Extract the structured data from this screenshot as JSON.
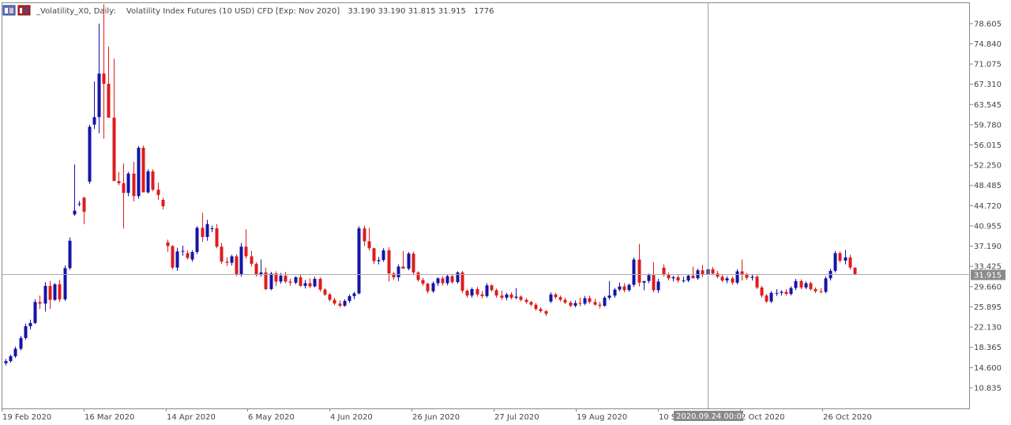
{
  "header": {
    "symbol": "_Volatility_X0, Daily:",
    "description": "Volatility Index Futures (10 USD) CFD [Exp: Nov 2020]",
    "ohlc": "33.190 33.190 31.815 31.915",
    "volume": "1776"
  },
  "crosshair": {
    "time_label": "2020.09.24 00:00"
  },
  "chart_data": {
    "type": "candlestick",
    "y_ticks": [
      "78.605",
      "74.840",
      "71.075",
      "67.310",
      "63.545",
      "59.780",
      "56.015",
      "52.250",
      "48.485",
      "44.720",
      "40.955",
      "37.190",
      "33.425",
      "29.660",
      "25.895",
      "22.130",
      "18.365",
      "14.600",
      "10.835"
    ],
    "ylim": [
      7.0,
      82.4
    ],
    "x_ticks": [
      "19 Feb 2020",
      "16 Mar 2020",
      "14 Apr 2020",
      "6 May 2020",
      "4 Jun 2020",
      "26 Jun 2020",
      "27 Jul 2020",
      "19 Aug 2020",
      "10 Sep 2020",
      "2 Oct 2020",
      "26 Oct 2020"
    ],
    "current_price": "31.915",
    "colors": {
      "bull": "#1414a8",
      "bear": "#dd1c1c",
      "grid": "#9aa0a6",
      "price_line": "#a9a9a9",
      "label_bg": "#8a8a8a"
    },
    "candles": [
      [
        15.4,
        16.2,
        15.0,
        15.8
      ],
      [
        15.8,
        17.0,
        15.5,
        16.7
      ],
      [
        16.7,
        18.5,
        16.4,
        18.1
      ],
      [
        18.1,
        20.5,
        17.8,
        20.1
      ],
      [
        20.1,
        22.8,
        19.8,
        22.3
      ],
      [
        22.3,
        23.5,
        21.7,
        22.9
      ],
      [
        22.9,
        27.3,
        22.7,
        26.8
      ],
      [
        26.8,
        28.0,
        25.5,
        26.5
      ],
      [
        26.5,
        30.5,
        25.0,
        29.8
      ],
      [
        29.8,
        30.7,
        25.5,
        27.2
      ],
      [
        27.2,
        30.3,
        27.0,
        30.1
      ],
      [
        30.1,
        30.9,
        26.8,
        27.3
      ],
      [
        27.3,
        33.6,
        27.0,
        33.1
      ],
      [
        33.1,
        38.8,
        32.8,
        38.2
      ],
      [
        43.1,
        52.4,
        42.8,
        43.8
      ],
      [
        45.1,
        45.6,
        44.6,
        45.1
      ],
      [
        46.2,
        46.4,
        41.3,
        43.6
      ],
      [
        49.2,
        59.8,
        48.8,
        59.4
      ],
      [
        59.8,
        67.8,
        59.0,
        61.2
      ],
      [
        61.2,
        78.6,
        58.2,
        69.3
      ],
      [
        69.3,
        82.2,
        57.2,
        67.4
      ],
      [
        67.4,
        74.3,
        64.8,
        61.1
      ],
      [
        61.1,
        72.1,
        49.6,
        49.3
      ],
      [
        49.3,
        51.0,
        48.5,
        48.9
      ],
      [
        48.9,
        52.6,
        40.5,
        47.1
      ],
      [
        47.1,
        51.0,
        46.5,
        50.7
      ],
      [
        50.7,
        52.9,
        45.5,
        46.5
      ],
      [
        46.5,
        55.8,
        46.0,
        55.5
      ],
      [
        55.5,
        55.9,
        49.4,
        47.2
      ],
      [
        47.2,
        51.5,
        47.0,
        51.1
      ],
      [
        51.1,
        51.5,
        47.4,
        47.7
      ],
      [
        47.7,
        49.0,
        45.8,
        46.7
      ],
      [
        45.8,
        46.2,
        44.0,
        44.6
      ],
      [
        37.9,
        38.4,
        36.1,
        37.2
      ],
      [
        37.2,
        37.4,
        32.9,
        33.2
      ],
      [
        33.2,
        36.9,
        32.6,
        36.2
      ],
      [
        36.2,
        37.3,
        35.4,
        36.3
      ],
      [
        35.9,
        36.4,
        34.7,
        35.0
      ],
      [
        34.7,
        36.4,
        34.3,
        36.1
      ],
      [
        36.1,
        40.9,
        35.7,
        40.6
      ],
      [
        40.6,
        43.4,
        38.0,
        38.9
      ],
      [
        38.9,
        42.1,
        38.2,
        41.3
      ],
      [
        40.5,
        41.0,
        39.8,
        40.5
      ],
      [
        40.5,
        41.3,
        36.8,
        37.1
      ],
      [
        37.1,
        37.8,
        33.9,
        34.3
      ],
      [
        34.3,
        35.1,
        33.5,
        34.1
      ],
      [
        34.1,
        35.6,
        33.6,
        35.3
      ],
      [
        35.3,
        35.7,
        31.6,
        31.9
      ],
      [
        31.9,
        37.8,
        31.5,
        37.1
      ],
      [
        37.1,
        40.3,
        34.9,
        35.3
      ],
      [
        35.3,
        36.3,
        33.4,
        33.9
      ],
      [
        33.9,
        34.2,
        31.5,
        32.0
      ],
      [
        32.0,
        34.7,
        31.5,
        32.3
      ],
      [
        32.3,
        33.2,
        29.0,
        29.2
      ],
      [
        29.2,
        32.4,
        29.0,
        32.1
      ],
      [
        32.1,
        32.5,
        29.8,
        30.6
      ],
      [
        30.6,
        32.2,
        30.2,
        31.7
      ],
      [
        31.7,
        32.4,
        30.3,
        30.6
      ],
      [
        30.6,
        31.1,
        29.8,
        30.4
      ],
      [
        30.4,
        31.6,
        30.1,
        31.4
      ],
      [
        31.4,
        31.9,
        29.6,
        29.8
      ],
      [
        29.8,
        30.9,
        29.3,
        30.3
      ],
      [
        30.3,
        31.2,
        29.4,
        29.7
      ],
      [
        29.7,
        31.5,
        29.5,
        31.1
      ],
      [
        31.1,
        31.4,
        28.7,
        29.1
      ],
      [
        29.1,
        29.4,
        27.9,
        28.2
      ],
      [
        28.2,
        28.5,
        26.9,
        27.2
      ],
      [
        27.2,
        27.6,
        26.2,
        26.5
      ],
      [
        26.5,
        27.1,
        25.8,
        26.1
      ],
      [
        26.1,
        27.3,
        25.9,
        27.0
      ],
      [
        27.0,
        28.2,
        26.6,
        27.9
      ],
      [
        27.9,
        28.7,
        27.3,
        28.4
      ],
      [
        28.4,
        40.9,
        28.2,
        40.5
      ],
      [
        40.5,
        41.0,
        37.2,
        38.1
      ],
      [
        38.1,
        40.6,
        36.4,
        36.8
      ],
      [
        36.8,
        36.9,
        33.9,
        34.4
      ],
      [
        34.4,
        35.2,
        33.8,
        34.6
      ],
      [
        34.6,
        36.8,
        34.3,
        36.4
      ],
      [
        36.4,
        37.0,
        30.6,
        32.1
      ],
      [
        32.1,
        32.4,
        30.9,
        31.4
      ],
      [
        31.4,
        33.8,
        30.7,
        33.4
      ],
      [
        33.4,
        36.3,
        33.0,
        33.0
      ],
      [
        33.0,
        36.1,
        32.7,
        35.8
      ],
      [
        35.8,
        36.2,
        31.8,
        32.3
      ],
      [
        32.3,
        32.5,
        30.6,
        30.9
      ],
      [
        30.9,
        31.3,
        29.8,
        30.2
      ],
      [
        30.2,
        30.4,
        28.4,
        28.8
      ],
      [
        28.8,
        30.6,
        28.5,
        30.3
      ],
      [
        30.3,
        31.4,
        29.8,
        31.2
      ],
      [
        31.2,
        31.6,
        29.9,
        30.3
      ],
      [
        30.3,
        31.9,
        29.9,
        31.6
      ],
      [
        31.6,
        32.0,
        30.2,
        30.5
      ],
      [
        30.5,
        32.5,
        30.2,
        32.3
      ],
      [
        32.3,
        32.6,
        28.5,
        28.9
      ],
      [
        28.9,
        29.1,
        27.6,
        28.0
      ],
      [
        28.0,
        29.5,
        27.6,
        29.2
      ],
      [
        29.2,
        29.6,
        27.8,
        28.2
      ],
      [
        28.2,
        28.8,
        27.5,
        27.9
      ],
      [
        27.9,
        30.3,
        27.6,
        29.9
      ],
      [
        29.9,
        30.1,
        28.7,
        29.0
      ],
      [
        29.0,
        29.3,
        27.6,
        28.0
      ],
      [
        28.0,
        28.9,
        27.2,
        27.6
      ],
      [
        27.6,
        28.5,
        27.1,
        28.2
      ],
      [
        28.2,
        28.6,
        27.3,
        27.6
      ],
      [
        27.6,
        29.4,
        27.3,
        27.8
      ],
      [
        27.8,
        28.0,
        26.9,
        27.2
      ],
      [
        27.2,
        27.5,
        26.5,
        26.8
      ],
      [
        26.8,
        27.0,
        26.0,
        26.3
      ],
      [
        26.3,
        26.6,
        25.2,
        25.5
      ],
      [
        25.5,
        25.8,
        24.8,
        25.1
      ],
      [
        25.1,
        25.3,
        24.2,
        24.6
      ],
      [
        26.9,
        28.6,
        26.6,
        28.2
      ],
      [
        28.2,
        28.5,
        27.4,
        27.7
      ],
      [
        27.7,
        28.0,
        26.9,
        27.2
      ],
      [
        27.2,
        27.6,
        26.4,
        26.7
      ],
      [
        26.7,
        27.0,
        25.8,
        26.1
      ],
      [
        26.1,
        27.1,
        25.8,
        26.6
      ],
      [
        26.6,
        27.6,
        26.0,
        26.5
      ],
      [
        26.5,
        27.9,
        26.2,
        27.5
      ],
      [
        27.5,
        28.0,
        26.5,
        26.8
      ],
      [
        26.8,
        27.4,
        26.1,
        26.3
      ],
      [
        26.3,
        26.8,
        25.6,
        26.1
      ],
      [
        26.1,
        27.9,
        25.9,
        27.6
      ],
      [
        27.6,
        30.7,
        27.2,
        28.0
      ],
      [
        28.0,
        29.4,
        27.6,
        29.1
      ],
      [
        29.1,
        30.4,
        28.8,
        29.7
      ],
      [
        29.7,
        30.3,
        28.6,
        29.0
      ],
      [
        29.0,
        30.2,
        28.7,
        30.0
      ],
      [
        30.0,
        35.1,
        29.6,
        34.7
      ],
      [
        34.7,
        37.6,
        29.7,
        30.4
      ],
      [
        30.4,
        30.7,
        29.0,
        30.7
      ],
      [
        30.7,
        32.1,
        30.3,
        31.8
      ],
      [
        31.8,
        34.2,
        28.6,
        29.0
      ],
      [
        29.0,
        31.1,
        28.5,
        30.6
      ],
      [
        33.2,
        33.8,
        31.5,
        31.9
      ],
      [
        31.9,
        32.3,
        30.8,
        31.2
      ],
      [
        31.2,
        31.7,
        30.6,
        31.4
      ],
      [
        31.4,
        31.8,
        30.4,
        30.8
      ],
      [
        30.8,
        31.5,
        30.4,
        30.8
      ],
      [
        30.8,
        32.0,
        30.5,
        31.7
      ],
      [
        31.7,
        33.4,
        31.3,
        31.2
      ],
      [
        31.2,
        33.0,
        30.9,
        32.7
      ],
      [
        32.7,
        33.7,
        31.4,
        32.0
      ],
      [
        32.0,
        33.3,
        31.6,
        32.9
      ],
      [
        32.9,
        33.3,
        31.8,
        32.1
      ],
      [
        32.1,
        32.6,
        31.2,
        31.5
      ],
      [
        31.5,
        31.9,
        30.5,
        30.8
      ],
      [
        30.8,
        31.6,
        30.3,
        31.2
      ],
      [
        31.2,
        31.5,
        30.0,
        30.4
      ],
      [
        30.4,
        32.9,
        30.1,
        32.5
      ],
      [
        32.5,
        34.7,
        30.8,
        31.9
      ],
      [
        31.9,
        32.2,
        30.9,
        31.3
      ],
      [
        31.3,
        31.9,
        30.8,
        31.5
      ],
      [
        31.5,
        31.8,
        29.2,
        29.5
      ],
      [
        29.5,
        29.8,
        27.6,
        28.0
      ],
      [
        28.0,
        28.3,
        26.6,
        26.9
      ],
      [
        26.9,
        28.8,
        26.6,
        28.5
      ],
      [
        28.5,
        29.2,
        27.9,
        28.5
      ],
      [
        28.5,
        29.0,
        28.0,
        28.7
      ],
      [
        28.7,
        29.2,
        28.0,
        28.3
      ],
      [
        28.3,
        29.7,
        28.0,
        29.4
      ],
      [
        29.4,
        31.1,
        29.0,
        30.7
      ],
      [
        30.7,
        31.0,
        29.2,
        29.5
      ],
      [
        29.5,
        30.6,
        29.2,
        30.3
      ],
      [
        30.3,
        30.6,
        28.9,
        29.2
      ],
      [
        29.2,
        29.5,
        28.5,
        28.8
      ],
      [
        28.8,
        29.4,
        28.4,
        28.7
      ],
      [
        28.7,
        31.6,
        28.4,
        31.2
      ],
      [
        31.2,
        33.0,
        30.8,
        32.6
      ],
      [
        32.6,
        36.3,
        32.3,
        35.9
      ],
      [
        35.9,
        36.2,
        34.1,
        34.5
      ],
      [
        34.5,
        36.5,
        33.8,
        35.1
      ],
      [
        35.1,
        35.6,
        32.8,
        33.2
      ],
      [
        33.2,
        33.2,
        31.8,
        31.9
      ]
    ]
  }
}
